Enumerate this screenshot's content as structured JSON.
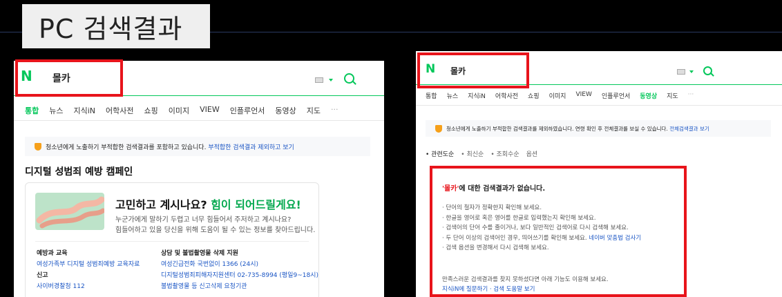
{
  "caption": "PC 검색결과",
  "logo": "N",
  "left": {
    "query": "몰카",
    "tabs": [
      "통합",
      "뉴스",
      "지식iN",
      "어학사전",
      "쇼핑",
      "이미지",
      "VIEW",
      "인플루언서",
      "동영상",
      "지도",
      "···"
    ],
    "active_tab": "통합",
    "notice_text": "청소년에게 노출하기 부적합한 검색결과를 포함하고 있습니다.",
    "notice_link": "부적합한 검색결과 제외하고 보기",
    "section_title": "디지털 성범죄 예방 캠페인",
    "campaign": {
      "headline_a": "고민하고 계시나요?",
      "headline_b": "힘이 되어드릴게요!",
      "desc1": "누군가에게 말하기 두렵고 너무 힘들어서 주저하고 계시나요?",
      "desc2": "힘들어하고 있을 당신을 위해 도움이 될 수 있는 정보를 찾아드립니다."
    },
    "col1": {
      "heading": "예방과 교육",
      "link": "여성가족부 디지털 성범죄예방 교육자료",
      "heading2": "신고",
      "link2": "사이버경찰청 112"
    },
    "col2": {
      "heading": "상담 및 불법촬영물 삭제 지원",
      "line1": "여성긴급전화 국번없이 1366 (24시)",
      "line2": "디지털성범죄피해자지원센터 02-735-8994 (평일9~18시)",
      "line3": "불법촬영물 등 신고삭제 요청기관"
    }
  },
  "right": {
    "query": "몰카",
    "tabs": [
      "통합",
      "뉴스",
      "지식iN",
      "어학사전",
      "쇼핑",
      "이미지",
      "VIEW",
      "인플루언서",
      "동영상",
      "지도",
      "···"
    ],
    "active_tab": "동영상",
    "notice_text": "청소년에게 노출하기 부적합한 검색결과를 제외하였습니다. 연령 확인 후 전체결과를 보실 수 있습니다.",
    "notice_link": "전체검색결과 보기",
    "sort": [
      "• 관련도순",
      "• 최신순",
      "• 조회수순",
      "옵션"
    ],
    "no_result_query": "'몰카'",
    "no_result_text": "에 대한 검색결과가 없습니다.",
    "tips": [
      "· 단어의 철자가 정확한지 확인해 보세요.",
      "· 한글을 영어로 혹은 영어를 한글로 입력했는지 확인해 보세요.",
      "· 검색어의 단어 수를 줄이거나, 보다 일반적인 검색어로 다시 검색해 보세요.",
      "· 두 단어 이상의 검색어인 경우, 띄어쓰기를 확인해 보세요.",
      "· 검색 옵션을 변경해서 다시 검색해 보세요."
    ],
    "tip_link": "네이버 맞춤법 검사기",
    "foot_text": "만족스러운 검색결과를 찾지 못하셨다면 아래 기능도 이용해 보세요.",
    "foot_links": "지식iN에 질문하기 · 검색 도움말 보기"
  },
  "colors": {
    "naver_green": "#03c75a",
    "highlight_red": "#e8141b",
    "link_blue": "#1a55c4"
  }
}
